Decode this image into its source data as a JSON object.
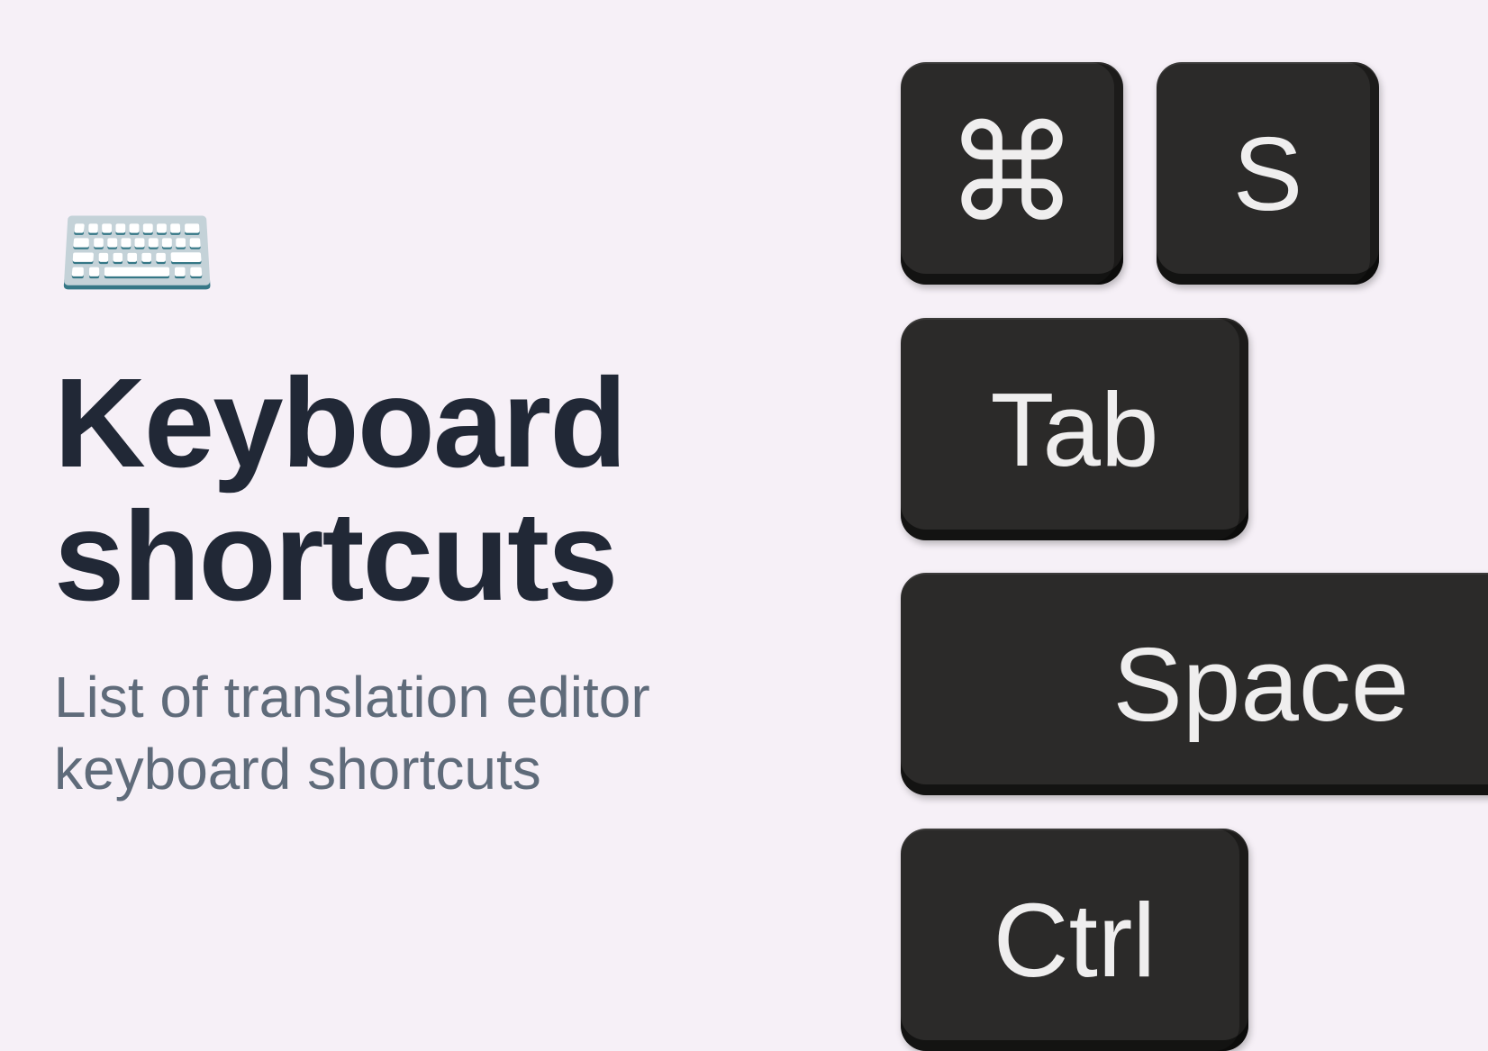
{
  "left": {
    "icon_glyph": "⌨️",
    "title_line1": "Keyboard",
    "title_line2": "shortcuts",
    "subtitle_line1": "List of translation editor",
    "subtitle_line2": "keyboard shortcuts"
  },
  "keys": {
    "cmd": "⌘",
    "s": "S",
    "tab": "Tab",
    "space": "Space",
    "ctrl": "Ctrl"
  }
}
